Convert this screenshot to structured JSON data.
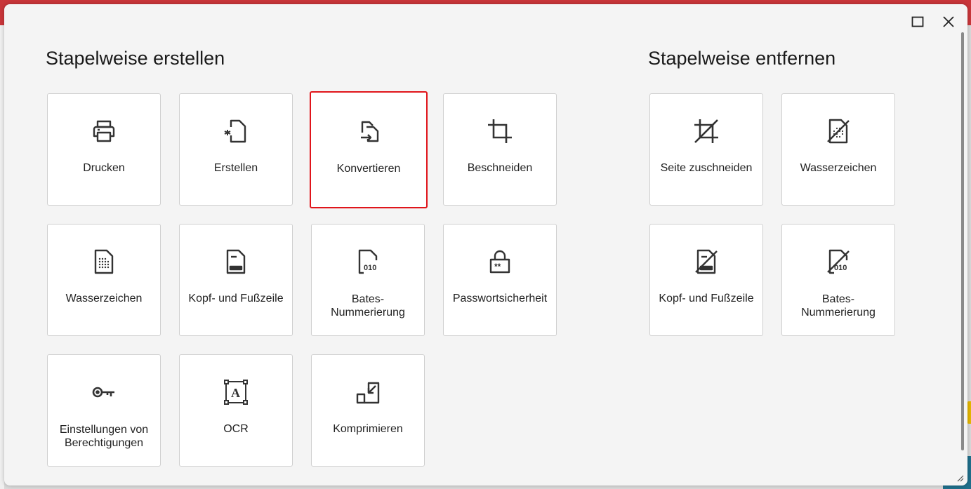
{
  "window": {
    "maximize_icon": "maximize-icon",
    "close_icon": "close-icon"
  },
  "create_section": {
    "title": "Stapelweise erstellen",
    "tiles": [
      {
        "label": "Drucken",
        "icon": "printer-icon"
      },
      {
        "label": "Erstellen",
        "icon": "create-document-icon"
      },
      {
        "label": "Konvertieren",
        "icon": "convert-icon",
        "selected": true
      },
      {
        "label": "Beschneiden",
        "icon": "crop-icon"
      },
      {
        "label": "Wasserzeichen",
        "icon": "watermark-icon"
      },
      {
        "label": "Kopf- und Fußzeile",
        "icon": "header-footer-icon"
      },
      {
        "label": "Bates-\nNummerierung",
        "icon": "bates-numbering-icon"
      },
      {
        "label": "Passwortsicherheit",
        "icon": "lock-icon"
      },
      {
        "label": "Einstellungen von\nBerechtigungen",
        "icon": "key-icon"
      },
      {
        "label": "OCR",
        "icon": "ocr-icon"
      },
      {
        "label": "Komprimieren",
        "icon": "compress-icon"
      }
    ]
  },
  "remove_section": {
    "title": "Stapelweise entfernen",
    "tiles": [
      {
        "label": "Seite zuschneiden",
        "icon": "remove-crop-icon"
      },
      {
        "label": "Wasserzeichen",
        "icon": "remove-watermark-icon"
      },
      {
        "label": "Kopf- und Fußzeile",
        "icon": "remove-header-footer-icon"
      },
      {
        "label": "Bates-\nNummerierung",
        "icon": "remove-bates-icon"
      }
    ]
  },
  "colors": {
    "selected_border": "#e0151b",
    "tile_background": "#ffffff",
    "dialog_background": "#f4f4f4"
  }
}
